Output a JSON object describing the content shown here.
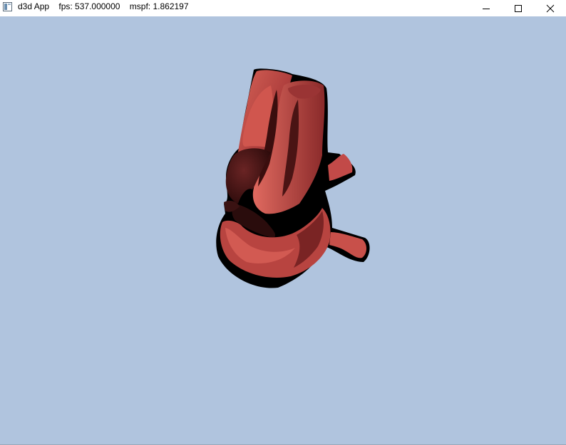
{
  "window": {
    "title": "d3d App    fps: 537.000000    mspf: 1.862197",
    "icon": "app-window-icon",
    "controls": {
      "minimize_icon": "minimize-icon",
      "maximize_icon": "maximize-icon",
      "close_icon": "close-icon"
    }
  },
  "viewport": {
    "background_color": "#b0c4de",
    "model_color": "#c24a48",
    "shadow_color": "#000000"
  }
}
